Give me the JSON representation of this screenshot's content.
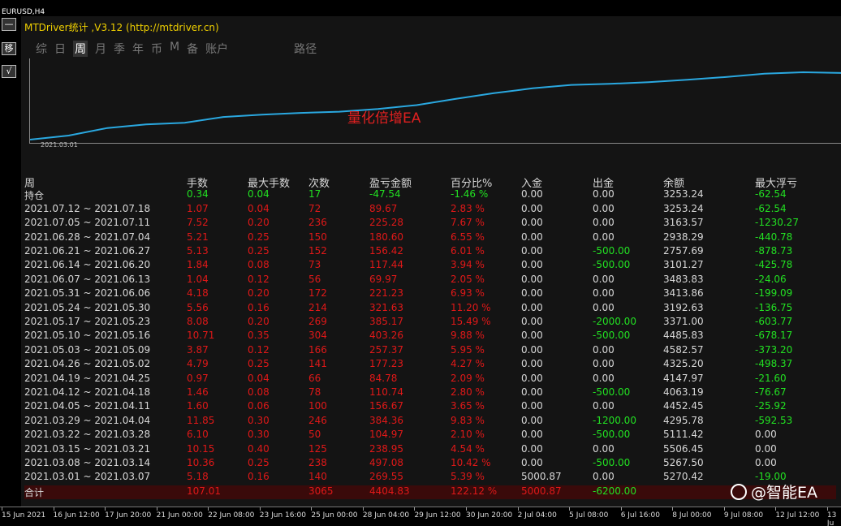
{
  "symbol": "EURUSD,H4",
  "panel": {
    "title": "MTDriver统计 ,V3.12 (http://mtdriver.cn)",
    "gutter_buttons": [
      "—",
      "移",
      "√"
    ],
    "tabs": [
      "综",
      "日",
      "周",
      "月",
      "季",
      "年",
      "币",
      "M",
      "备",
      "账户",
      "路径"
    ],
    "active_tab": "周",
    "curve_start_date": "2021.03.01",
    "watermark": "量化倍增EA"
  },
  "colors": {
    "curve": "#2aa8e0",
    "profit": "#e01818",
    "loss": "#22e022"
  },
  "table": {
    "headers": [
      "周",
      "手数",
      "最大手数",
      "次数",
      "盈亏金额",
      "百分比%",
      "入金",
      "出金",
      "余额",
      "最大浮亏"
    ],
    "holding": [
      "持仓",
      "0.34",
      "0.04",
      "17",
      "-47.54",
      "-1.46 %",
      "0.00",
      "0.00",
      "3253.24",
      "-62.54"
    ],
    "rows": [
      [
        "2021.07.12 ~ 2021.07.18",
        "1.07",
        "0.04",
        "72",
        "89.67",
        "2.83 %",
        "0.00",
        "0.00",
        "3253.24",
        "-62.54"
      ],
      [
        "2021.07.05 ~ 2021.07.11",
        "7.52",
        "0.20",
        "236",
        "225.28",
        "7.67 %",
        "0.00",
        "0.00",
        "3163.57",
        "-1230.27"
      ],
      [
        "2021.06.28 ~ 2021.07.04",
        "5.21",
        "0.25",
        "150",
        "180.60",
        "6.55 %",
        "0.00",
        "0.00",
        "2938.29",
        "-440.78"
      ],
      [
        "2021.06.21 ~ 2021.06.27",
        "5.13",
        "0.25",
        "152",
        "156.42",
        "6.01 %",
        "0.00",
        "-500.00",
        "2757.69",
        "-878.73"
      ],
      [
        "2021.06.14 ~ 2021.06.20",
        "1.84",
        "0.08",
        "73",
        "117.44",
        "3.94 %",
        "0.00",
        "-500.00",
        "3101.27",
        "-425.78"
      ],
      [
        "2021.06.07 ~ 2021.06.13",
        "1.04",
        "0.12",
        "56",
        "69.97",
        "2.05 %",
        "0.00",
        "0.00",
        "3483.83",
        "-24.06"
      ],
      [
        "2021.05.31 ~ 2021.06.06",
        "4.18",
        "0.20",
        "172",
        "221.23",
        "6.93 %",
        "0.00",
        "0.00",
        "3413.86",
        "-199.09"
      ],
      [
        "2021.05.24 ~ 2021.05.30",
        "5.56",
        "0.16",
        "214",
        "321.63",
        "11.20 %",
        "0.00",
        "0.00",
        "3192.63",
        "-136.75"
      ],
      [
        "2021.05.17 ~ 2021.05.23",
        "8.08",
        "0.20",
        "269",
        "385.17",
        "15.49 %",
        "0.00",
        "-2000.00",
        "3371.00",
        "-603.77"
      ],
      [
        "2021.05.10 ~ 2021.05.16",
        "10.71",
        "0.35",
        "304",
        "403.26",
        "9.88 %",
        "0.00",
        "-500.00",
        "4485.83",
        "-678.17"
      ],
      [
        "2021.05.03 ~ 2021.05.09",
        "3.87",
        "0.12",
        "166",
        "257.37",
        "5.95 %",
        "0.00",
        "0.00",
        "4582.57",
        "-373.20"
      ],
      [
        "2021.04.26 ~ 2021.05.02",
        "4.79",
        "0.25",
        "141",
        "177.23",
        "4.27 %",
        "0.00",
        "0.00",
        "4325.20",
        "-498.37"
      ],
      [
        "2021.04.19 ~ 2021.04.25",
        "0.97",
        "0.04",
        "66",
        "84.78",
        "2.09 %",
        "0.00",
        "0.00",
        "4147.97",
        "-21.60"
      ],
      [
        "2021.04.12 ~ 2021.04.18",
        "1.46",
        "0.08",
        "78",
        "110.74",
        "2.80 %",
        "0.00",
        "-500.00",
        "4063.19",
        "-76.67"
      ],
      [
        "2021.04.05 ~ 2021.04.11",
        "1.60",
        "0.06",
        "100",
        "156.67",
        "3.65 %",
        "0.00",
        "0.00",
        "4452.45",
        "-25.92"
      ],
      [
        "2021.03.29 ~ 2021.04.04",
        "11.85",
        "0.30",
        "246",
        "384.36",
        "9.83 %",
        "0.00",
        "-1200.00",
        "4295.78",
        "-592.53"
      ],
      [
        "2021.03.22 ~ 2021.03.28",
        "6.10",
        "0.30",
        "50",
        "104.97",
        "2.10 %",
        "0.00",
        "-500.00",
        "5111.42",
        "0.00"
      ],
      [
        "2021.03.15 ~ 2021.03.21",
        "10.15",
        "0.40",
        "125",
        "238.95",
        "4.54 %",
        "0.00",
        "0.00",
        "5506.45",
        "0.00"
      ],
      [
        "2021.03.08 ~ 2021.03.14",
        "10.36",
        "0.25",
        "238",
        "497.08",
        "10.42 %",
        "0.00",
        "-500.00",
        "5267.50",
        "0.00"
      ],
      [
        "2021.03.01 ~ 2021.03.07",
        "5.18",
        "0.16",
        "140",
        "269.55",
        "5.39 %",
        "5000.87",
        "0.00",
        "5270.42",
        "-19.00"
      ]
    ],
    "total": [
      "合计",
      "107.01",
      "",
      "3065",
      "4404.83",
      "122.12 %",
      "5000.87",
      "-6200.00",
      "",
      ""
    ]
  },
  "xaxis_labels": [
    "15 Jun 2021",
    "16 Jun 12:00",
    "17 Jun 20:00",
    "21 Jun 00:00",
    "22 Jun 08:00",
    "23 Jun 16:00",
    "25 Jun 00:00",
    "28 Jun 04:00",
    "29 Jun 12:00",
    "30 Jun 20:00",
    "2 Jul 04:00",
    "5 Jul 08:00",
    "6 Jul 16:00",
    "8 Jul 00:00",
    "9 Jul 08:00",
    "12 Jul 12:00",
    "13 Ju"
  ],
  "logo_text": "@智能EA"
}
